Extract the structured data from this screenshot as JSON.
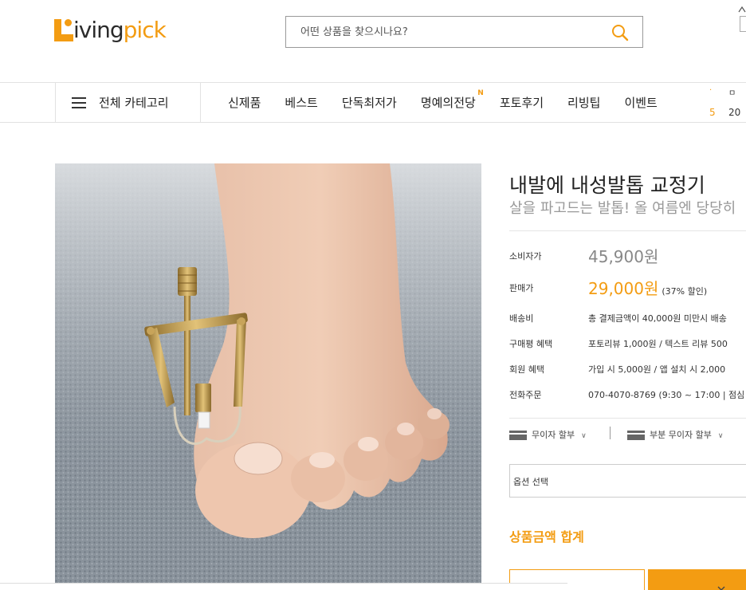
{
  "header": {
    "logo": {
      "prefix": "L",
      "part_a": "iving",
      "part_b": "pick",
      "brand_color": "#f39c12"
    },
    "search": {
      "placeholder": "어떤 상품을 찾으시나요?",
      "icon": "search-icon"
    }
  },
  "nav": {
    "category_label": "전체 카테고리",
    "items": [
      {
        "label": "신제품"
      },
      {
        "label": "베스트"
      },
      {
        "label": "단독최저가"
      },
      {
        "label": "명예의전당",
        "badge": "N"
      },
      {
        "label": "포토후기"
      },
      {
        "label": "리빙팁"
      },
      {
        "label": "이벤트"
      }
    ],
    "ranking": {
      "rank": "5",
      "text": "20"
    }
  },
  "product": {
    "image_alt": "내발에 내성발톱 교정기",
    "title": "내발에 내성발톱 교정기",
    "subtitle": "살을 파고드는 발톱! 올 여름엔 당당히",
    "rows": [
      {
        "key": "소비자가",
        "value": "45,900원"
      },
      {
        "key": "판매가",
        "value": "29,000원",
        "extra": "(37% 할인)"
      },
      {
        "key": "배송비",
        "value": "총 결제금액이 40,000원 미만시 배송"
      },
      {
        "key": "구매평 혜택",
        "value": "포토리뷰 1,000원 / 텍스트 리뷰 500"
      },
      {
        "key": "회원 혜택",
        "value": "가입 시 5,000원 / 앱 설치 시 2,000"
      },
      {
        "key": "전화주문",
        "value": "070-4070-8769 (9:30 ~ 17:00 | 점심"
      }
    ],
    "installment": [
      {
        "label": "무이자 할부"
      },
      {
        "label": "부분 무이자 할부"
      }
    ],
    "option_select": "옵션 선택",
    "total_label": "상품금액 합계"
  },
  "colors": {
    "accent": "#f39c12",
    "muted": "#999999",
    "border": "#e2e2e2"
  }
}
